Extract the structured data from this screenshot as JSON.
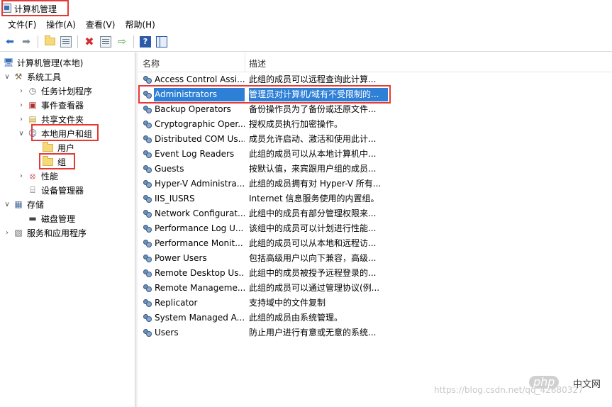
{
  "window": {
    "title": "计算机管理"
  },
  "menu": [
    "文件(F)",
    "操作(A)",
    "查看(V)",
    "帮助(H)"
  ],
  "toolbar": {
    "icons": [
      "back-arrow-icon",
      "forward-arrow-icon",
      "up-folder-icon",
      "show-hide-tree-icon",
      "delete-icon",
      "properties-icon",
      "export-list-icon",
      "help-icon",
      "action-pane-icon"
    ]
  },
  "tree": {
    "root": "计算机管理(本地)",
    "system_tools": "系统工具",
    "task_scheduler": "任务计划程序",
    "event_viewer": "事件查看器",
    "shared_folders": "共享文件夹",
    "local_users_groups": "本地用户和组",
    "users": "用户",
    "groups": "组",
    "performance": "性能",
    "device_manager": "设备管理器",
    "storage": "存储",
    "disk_management": "磁盘管理",
    "services_apps": "服务和应用程序"
  },
  "list": {
    "col_name": "名称",
    "col_desc": "描述",
    "rows": [
      {
        "name": "Access Control Assi...",
        "desc": "此组的成员可以远程查询此计算..."
      },
      {
        "name": "Administrators",
        "desc": "管理员对计算机/域有不受限制的..."
      },
      {
        "name": "Backup Operators",
        "desc": "备份操作员为了备份或还原文件..."
      },
      {
        "name": "Cryptographic Oper...",
        "desc": "授权成员执行加密操作。"
      },
      {
        "name": "Distributed COM Us...",
        "desc": "成员允许启动、激活和使用此计..."
      },
      {
        "name": "Event Log Readers",
        "desc": "此组的成员可以从本地计算机中..."
      },
      {
        "name": "Guests",
        "desc": "按默认值，来宾跟用户组的成员..."
      },
      {
        "name": "Hyper-V Administra...",
        "desc": "此组的成员拥有对 Hyper-V 所有..."
      },
      {
        "name": "IIS_IUSRS",
        "desc": "Internet 信息服务使用的内置组。"
      },
      {
        "name": "Network Configurat...",
        "desc": "此组中的成员有部分管理权限来..."
      },
      {
        "name": "Performance Log U...",
        "desc": "该组中的成员可以计划进行性能..."
      },
      {
        "name": "Performance Monit...",
        "desc": "此组的成员可以从本地和远程访..."
      },
      {
        "name": "Power Users",
        "desc": "包括高级用户以向下兼容，高级..."
      },
      {
        "name": "Remote Desktop Us...",
        "desc": "此组中的成员被授予远程登录的..."
      },
      {
        "name": "Remote Manageme...",
        "desc": "此组的成员可以通过管理协议(例..."
      },
      {
        "name": "Replicator",
        "desc": "支持域中的文件复制"
      },
      {
        "name": "System Managed A...",
        "desc": "此组的成员由系统管理。"
      },
      {
        "name": "Users",
        "desc": "防止用户进行有意或无意的系统..."
      }
    ]
  },
  "watermark": {
    "url": "https://blog.csdn.net/qq_42680327",
    "logo": "php",
    "cn": "中文网"
  },
  "colors": {
    "selection": "#2e7fd6",
    "highlight_box": "#e53935"
  }
}
